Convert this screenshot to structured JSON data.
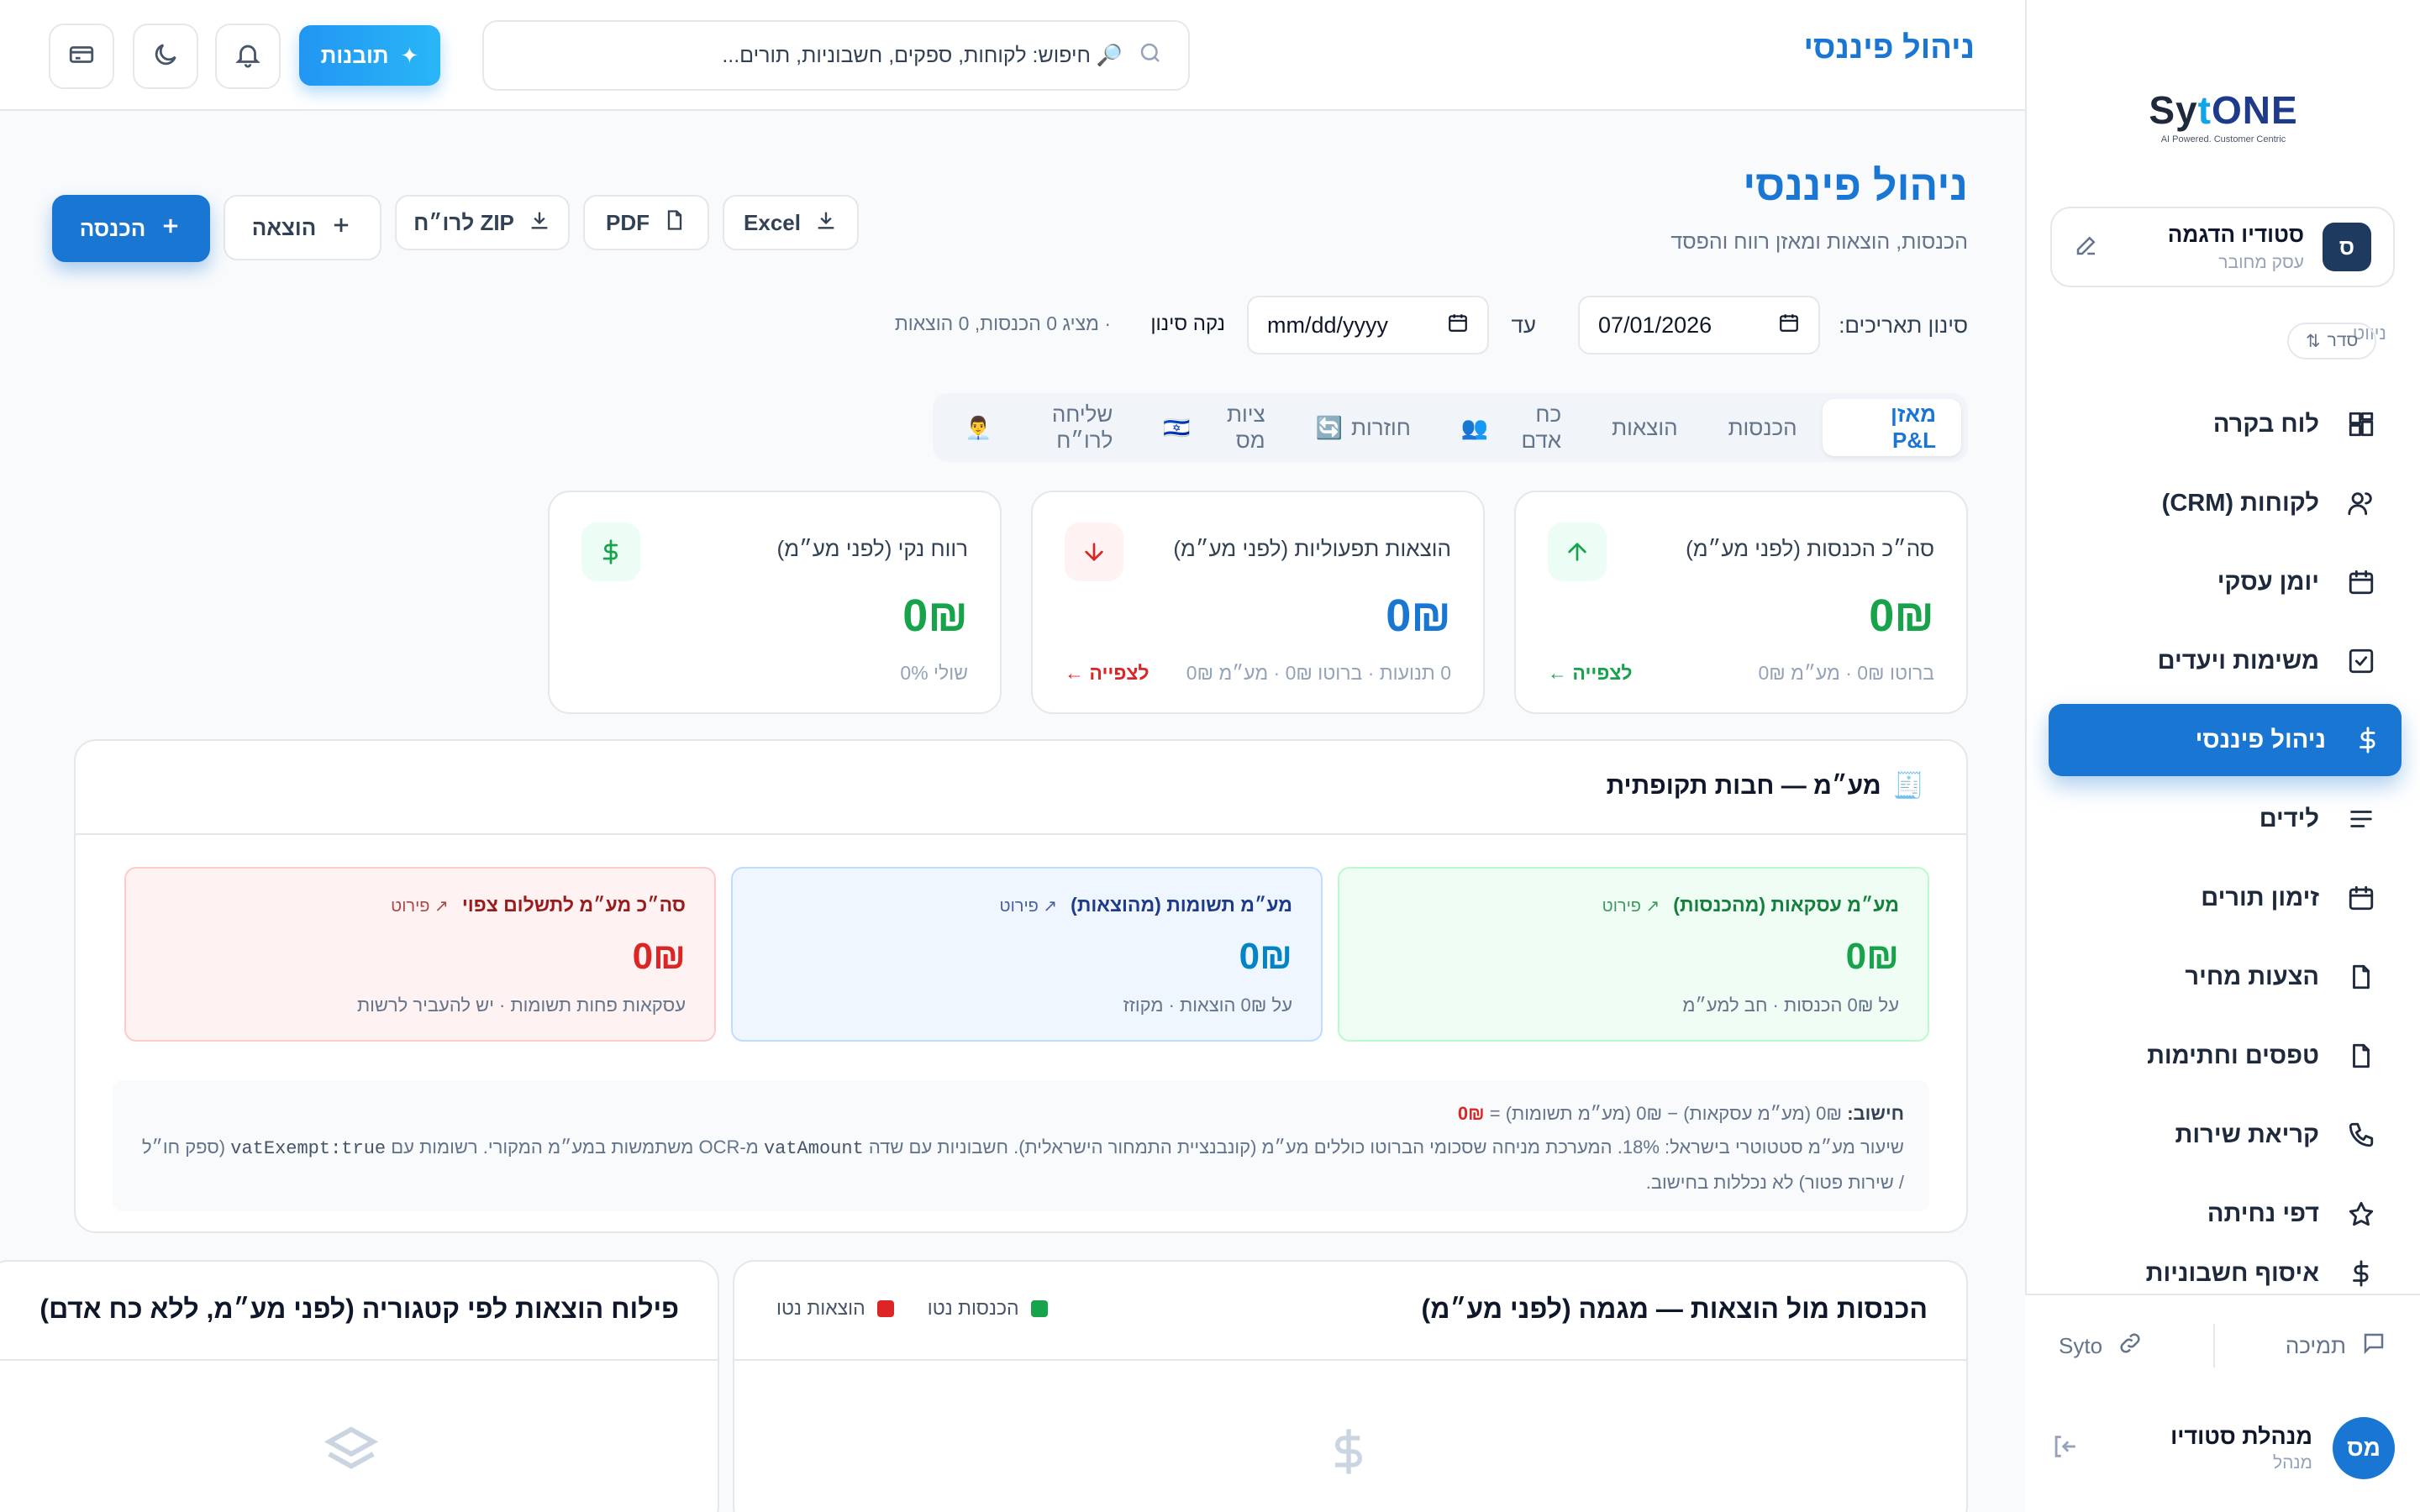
{
  "brand": {
    "logo_sy": "Sy",
    "logo_t": "t",
    "logo_one": "ONE",
    "tagline": "AI Powered. Customer Centric"
  },
  "business": {
    "avatar": "ס",
    "name": "סטודיו הדגמה",
    "subtitle": "עסק מחובר"
  },
  "sidebar": {
    "nav_label": "ניווט",
    "sort_label": "סדר",
    "items": [
      {
        "label": "לוח בקרה",
        "icon": "dashboard-icon"
      },
      {
        "label": "לקוחות (CRM)",
        "icon": "users-icon"
      },
      {
        "label": "יומן עסקי",
        "icon": "calendar-icon"
      },
      {
        "label": "משימות ויעדים",
        "icon": "checkbox-icon"
      },
      {
        "label": "ניהול פיננסי",
        "icon": "dollar-icon",
        "active": true
      },
      {
        "label": "לידים",
        "icon": "list-icon"
      },
      {
        "label": "זימון תורים",
        "icon": "calendar-icon"
      },
      {
        "label": "הצעות מחיר",
        "icon": "document-icon"
      },
      {
        "label": "טפסים וחתימות",
        "icon": "document-icon"
      },
      {
        "label": "קריאת שירות",
        "icon": "phone-icon"
      },
      {
        "label": "דפי נחיתה",
        "icon": "star-icon"
      },
      {
        "label": "איסוף חשבוניות",
        "icon": "dollar-icon"
      }
    ],
    "support_label": "תמיכה",
    "syto_label": "Syto",
    "user": {
      "avatar": "מס",
      "name": "מנהלת סטודיו",
      "role": "מנהל"
    }
  },
  "topbar": {
    "title": "ניהול פיננסי",
    "search_placeholder": "🔎 חיפוש: לקוחות, ספקים, חשבוניות, תורים...",
    "ai_button": "תובנות"
  },
  "page": {
    "title": "ניהול פיננסי",
    "subtitle": "הכנסות, הוצאות ומאזן רווח והפסד",
    "actions": {
      "income": "הכנסה",
      "expense": "הוצאה",
      "zip": "ZIP לרו״ח",
      "pdf": "PDF",
      "excel": "Excel"
    },
    "filter": {
      "label": "סינון תאריכים:",
      "from_value": "07/01/2026",
      "to_label": "עד",
      "to_value": "mm/dd/yyyy",
      "clear": "נקה סינון",
      "info": "· מציג 0 הכנסות, 0 הוצאות"
    },
    "tabs": [
      {
        "label": "מאזן P&L",
        "active": true,
        "emoji": ""
      },
      {
        "label": "הכנסות",
        "emoji": ""
      },
      {
        "label": "הוצאות",
        "emoji": ""
      },
      {
        "label": "כח אדם",
        "emoji": "👥"
      },
      {
        "label": "חוזרות",
        "emoji": "🔄"
      },
      {
        "label": "ציות מס",
        "emoji": "🇮🇱"
      },
      {
        "label": "שליחה לרו״ח",
        "emoji": "👨‍💼"
      }
    ]
  },
  "kpis": [
    {
      "title": "סה״כ הכנסות (לפני מע״מ)",
      "value": "0₪",
      "foot": "ברוטו 0₪ · מע״מ 0₪",
      "link": "לצפייה ←",
      "color": "#16a34a",
      "icon": "arrow-up-icon",
      "icon_bg": "#ecfdf5"
    },
    {
      "title": "הוצאות תפעוליות (לפני מע״מ)",
      "value": "0₪",
      "foot": "0 תנועות · ברוטו 0₪ · מע״מ 0₪",
      "link": "לצפייה ←",
      "color": "#1976d2",
      "link_color": "#dc2626",
      "icon": "arrow-down-icon",
      "icon_bg": "#fef2f2"
    },
    {
      "title": "רווח נקי (לפני מע״מ)",
      "value": "0₪",
      "foot": "שולי 0%",
      "link": "",
      "color": "#16a34a",
      "icon": "dollar-icon",
      "icon_bg": "#ecfdf5"
    }
  ],
  "vat": {
    "emoji": "🧾",
    "title": "מע״מ — חבות תקופתית",
    "boxes": [
      {
        "title": "מע״מ עסקאות (מהכנסות)",
        "detail": "↗ פירוט",
        "value": "0₪",
        "sub": "על 0₪ הכנסות · חב למע״מ",
        "color": "#15803d",
        "value_color": "#16a34a",
        "bg": "#f0fdf4",
        "border": "#bbf7d0"
      },
      {
        "title": "מע״מ תשומות (מהוצאות)",
        "detail": "↗ פירוט",
        "value": "0₪",
        "sub": "על 0₪ הוצאות · מקוזז",
        "color": "#1e3a8a",
        "value_color": "#0284c7",
        "bg": "#eff6ff",
        "border": "#bfdbfe"
      },
      {
        "title": "סה״כ מע״מ לתשלום צפוי",
        "detail": "↗ פירוט",
        "value": "0₪",
        "sub": "עסקאות פחות תשומות · יש להעביר לרשות",
        "color": "#991b1b",
        "value_color": "#dc2626",
        "bg": "#fef2f2",
        "border": "#fecaca"
      }
    ],
    "calc_label": "חישוב:",
    "calc_formula": "0₪ (מע״מ עסקאות) − 0₪ (מע״מ תשומות) =",
    "calc_result": "0₪",
    "note_1": "שיעור מע״מ סטטוטרי בישראל: 18%. המערכת מניחה שסכומי הברוטו כוללים מע״מ (קונבנציית התמחור הישראלית). חשבוניות עם שדה",
    "note_code_1": "vatAmount",
    "note_2": "מ-OCR משתמשות במע״מ המקורי. רשומות עם",
    "note_code_2": "vatExempt:true",
    "note_3": "(ספק חו״ל / שירות פטור) לא נכללות בחישוב."
  },
  "charts": {
    "trend_title": "הכנסות מול הוצאות — מגמה (לפני מע״מ)",
    "legend_income": "הכנסות נטו",
    "legend_expense": "הוצאות נטו",
    "income_color": "#16a34a",
    "expense_color": "#dc2626",
    "category_title": "פילוח הוצאות לפי קטגוריה (לפני מע״מ, ללא כח אדם)"
  }
}
